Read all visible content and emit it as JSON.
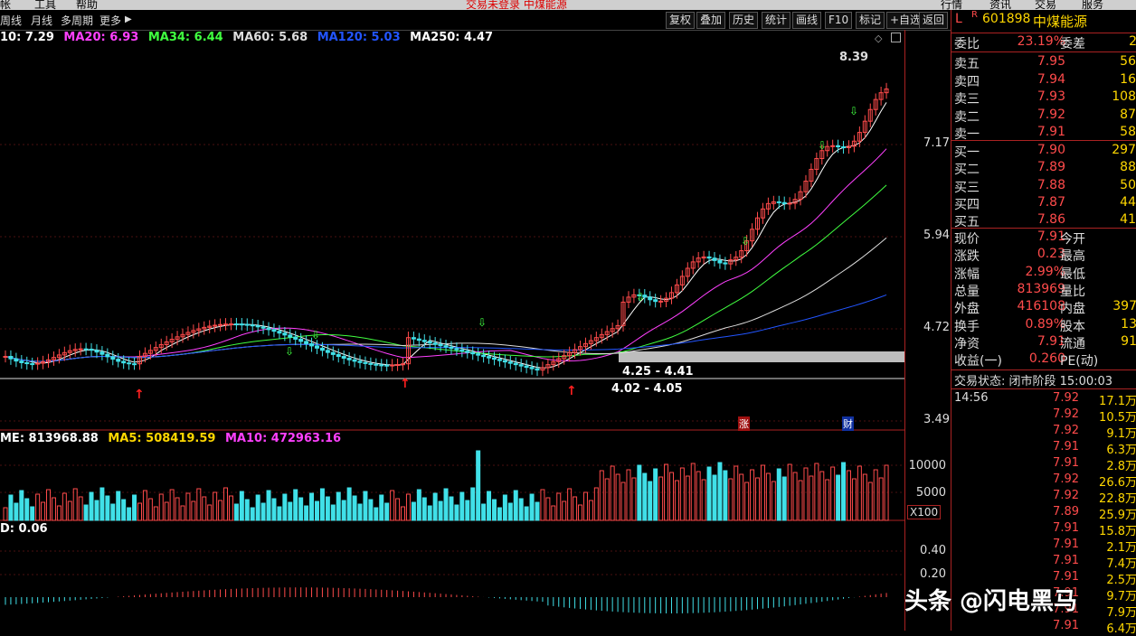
{
  "menubar": {
    "items": [
      "帐",
      "工具",
      "帮助"
    ],
    "title": "交易未登录  中煤能源",
    "right_items": [
      "行情",
      "资讯",
      "交易",
      "服务"
    ]
  },
  "toolbar": {
    "left": [
      "周线",
      "月线",
      "多周期",
      "更多"
    ],
    "buttons": [
      "复权",
      "叠加",
      "历史",
      "统计",
      "画线",
      "F10",
      "标记",
      "+自选",
      "返回"
    ]
  },
  "ma_legend": [
    {
      "text": "10: 7.29",
      "color": "#ffffff"
    },
    {
      "text": "MA20: 6.93",
      "color": "#ff40ff"
    },
    {
      "text": "MA34: 6.44",
      "color": "#40ff40"
    },
    {
      "text": "MA60: 5.68",
      "color": "#dddddd"
    },
    {
      "text": "MA120: 5.03",
      "color": "#2255ff"
    },
    {
      "text": "MA250: 4.47",
      "color": "#ffffff"
    }
  ],
  "price_axis": [
    "7.17",
    "5.94",
    "4.72",
    "3.49"
  ],
  "annotations": {
    "high": "8.39",
    "zone1": "4.25 - 4.41",
    "zone2": "4.02 - 4.05",
    "zhang": "涨",
    "cai": "财"
  },
  "volume": {
    "legend": [
      {
        "text": "ME: 813968.88",
        "color": "#ffffff"
      },
      {
        "text": "MA5: 508419.59",
        "color": "#ffd700"
      },
      {
        "text": "MA10: 472963.16",
        "color": "#ff40ff"
      }
    ],
    "axis": [
      "10000",
      "5000"
    ],
    "unit": "X100"
  },
  "indicator": {
    "legend": "D: 0.06",
    "axis": [
      "0.40",
      "0.20"
    ]
  },
  "quote": {
    "code": "601898",
    "name": "中煤能源",
    "prefix_l": "L",
    "prefix_r": "R",
    "weibi": {
      "label": "委比",
      "value": "23.19%",
      "label2": "委差",
      "value2": "2"
    },
    "sell": [
      {
        "label": "卖五",
        "price": "7.95",
        "vol": "56"
      },
      {
        "label": "卖四",
        "price": "7.94",
        "vol": "16"
      },
      {
        "label": "卖三",
        "price": "7.93",
        "vol": "108"
      },
      {
        "label": "卖二",
        "price": "7.92",
        "vol": "87"
      },
      {
        "label": "卖一",
        "price": "7.91",
        "vol": "58"
      }
    ],
    "buy": [
      {
        "label": "买一",
        "price": "7.90",
        "vol": "297"
      },
      {
        "label": "买二",
        "price": "7.89",
        "vol": "88"
      },
      {
        "label": "买三",
        "price": "7.88",
        "vol": "50"
      },
      {
        "label": "买四",
        "price": "7.87",
        "vol": "44"
      },
      {
        "label": "买五",
        "price": "7.86",
        "vol": "41"
      }
    ],
    "info": [
      {
        "l1": "现价",
        "v1": "7.91",
        "l2": "今开",
        "v2": ""
      },
      {
        "l1": "涨跌",
        "v1": "0.23",
        "l2": "最高",
        "v2": ""
      },
      {
        "l1": "涨幅",
        "v1": "2.99%",
        "l2": "最低",
        "v2": ""
      },
      {
        "l1": "总量",
        "v1": "813969",
        "l2": "量比",
        "v2": ""
      },
      {
        "l1": "外盘",
        "v1": "416108",
        "l2": "内盘",
        "v2": "397"
      },
      {
        "l1": "换手",
        "v1": "0.89%",
        "l2": "股本",
        "v2": "13"
      },
      {
        "l1": "净资",
        "v1": "7.91",
        "l2": "流通",
        "v2": "91"
      },
      {
        "l1": "收益(一)",
        "v1": "0.260",
        "l2": "PE(动)",
        "v2": ""
      }
    ],
    "status": "交易状态: 闭市阶段 15:00:03",
    "ticks": [
      {
        "t": "14:56",
        "p": "7.92",
        "v": "17.1万"
      },
      {
        "t": "",
        "p": "7.92",
        "v": "10.5万"
      },
      {
        "t": "",
        "p": "7.92",
        "v": "9.1万"
      },
      {
        "t": "",
        "p": "7.91",
        "v": "6.3万"
      },
      {
        "t": "",
        "p": "7.91",
        "v": "2.8万"
      },
      {
        "t": "",
        "p": "7.92",
        "v": "26.6万"
      },
      {
        "t": "",
        "p": "7.92",
        "v": "22.8万"
      },
      {
        "t": "",
        "p": "7.89",
        "v": "25.9万"
      },
      {
        "t": "",
        "p": "7.91",
        "v": "15.8万"
      },
      {
        "t": "",
        "p": "7.91",
        "v": "2.1万"
      },
      {
        "t": "",
        "p": "7.91",
        "v": "7.4万"
      },
      {
        "t": "",
        "p": "7.91",
        "v": "2.5万"
      },
      {
        "t": "",
        "p": "7.91",
        "v": "9.7万"
      },
      {
        "t": "",
        "p": "7.91",
        "v": "7.9万"
      },
      {
        "t": "",
        "p": "7.91",
        "v": "6.4万"
      }
    ]
  },
  "watermark": "头条 @闪电黑马",
  "colors": {
    "up": "#ff4b4b",
    "down": "#40e0e8",
    "panel_border": "#aa2222"
  }
}
